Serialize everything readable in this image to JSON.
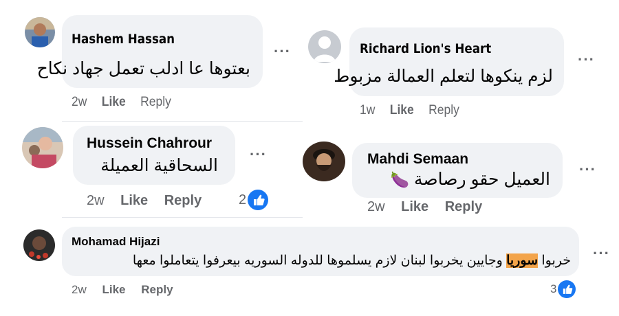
{
  "comments": [
    {
      "name": "Hashem Hassan",
      "text": "بعتوها عا ادلب تعمل جهاد نكاح",
      "time": "2w",
      "like": "Like",
      "reply": "Reply",
      "more": "···"
    },
    {
      "name": "Richard Lion's Heart",
      "text": "لزم ينكوها لتعلم العمالة مزبوط",
      "time": "1w",
      "like": "Like",
      "reply": "Reply",
      "more": "···"
    },
    {
      "name": "Hussein Chahrour",
      "text": "السحاقية العميلة",
      "time": "2w",
      "like": "Like",
      "reply": "Reply",
      "reactions": "2",
      "more": "···"
    },
    {
      "name": "Mahdi Semaan",
      "text": "العميل حقو رصاصة",
      "emoji": "🍆",
      "time": "2w",
      "like": "Like",
      "reply": "Reply",
      "more": "···"
    },
    {
      "name": "Mohamad Hijazi",
      "text_before": "خربوا ",
      "text_highlight": "سوريا",
      "text_after": " وجايين يخربوا لبنان لازم يسلموها للدوله السوريه بيعرفوا يتعاملوا معها",
      "time": "2w",
      "like": "Like",
      "reply": "Reply",
      "reactions": "3",
      "more": "···"
    }
  ],
  "colors": {
    "bubble": "#f0f2f5",
    "meta": "#65676b",
    "like_blue": "#1877f2",
    "highlight": "#f3a44a"
  }
}
